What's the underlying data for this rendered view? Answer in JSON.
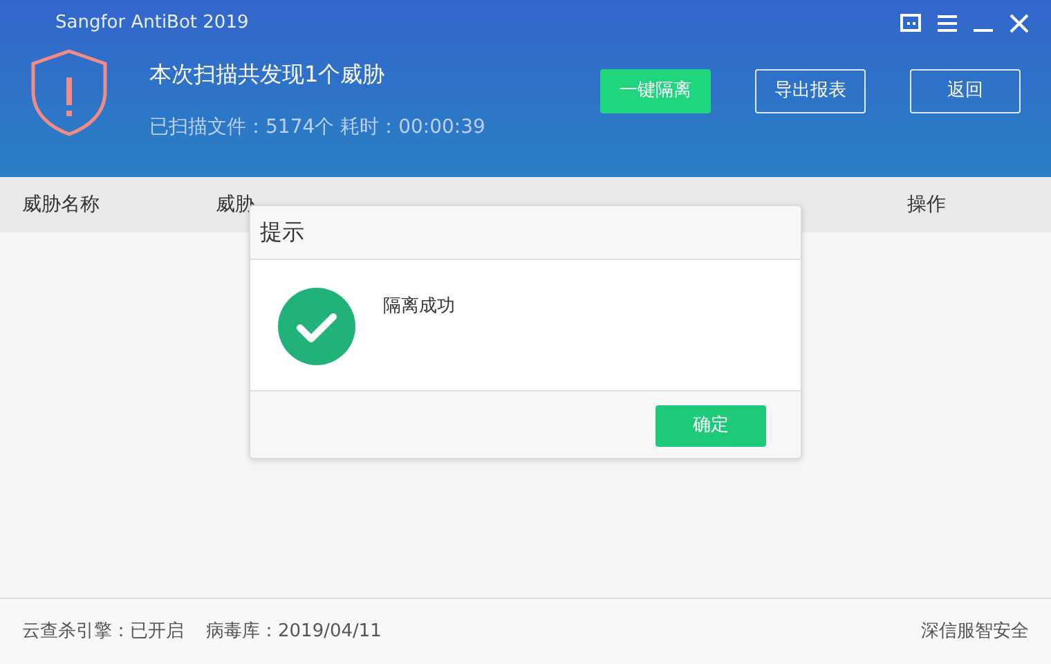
{
  "window": {
    "title": "Sangfor AntiBot 2019"
  },
  "scan_summary": {
    "headline": "本次扫描共发现1个威胁",
    "details": "已扫描文件：5174个 耗时：00:00:39"
  },
  "actions": [
    {
      "label": "一键隔离",
      "kind": "primary"
    },
    {
      "label": "导出报表",
      "kind": "outline"
    },
    {
      "label": "返回",
      "kind": "outline"
    }
  ],
  "table": {
    "columns": [
      {
        "label": "威胁名称"
      },
      {
        "label": "威胁"
      },
      {
        "label": "操作"
      }
    ]
  },
  "dialog": {
    "title": "提示",
    "message": "隔离成功",
    "button": "确定"
  },
  "status_bar": {
    "cloud_engine": "云查杀引擎：已开启",
    "virus_db": "病毒库：2019/04/11",
    "brand": "深信服智安全"
  }
}
